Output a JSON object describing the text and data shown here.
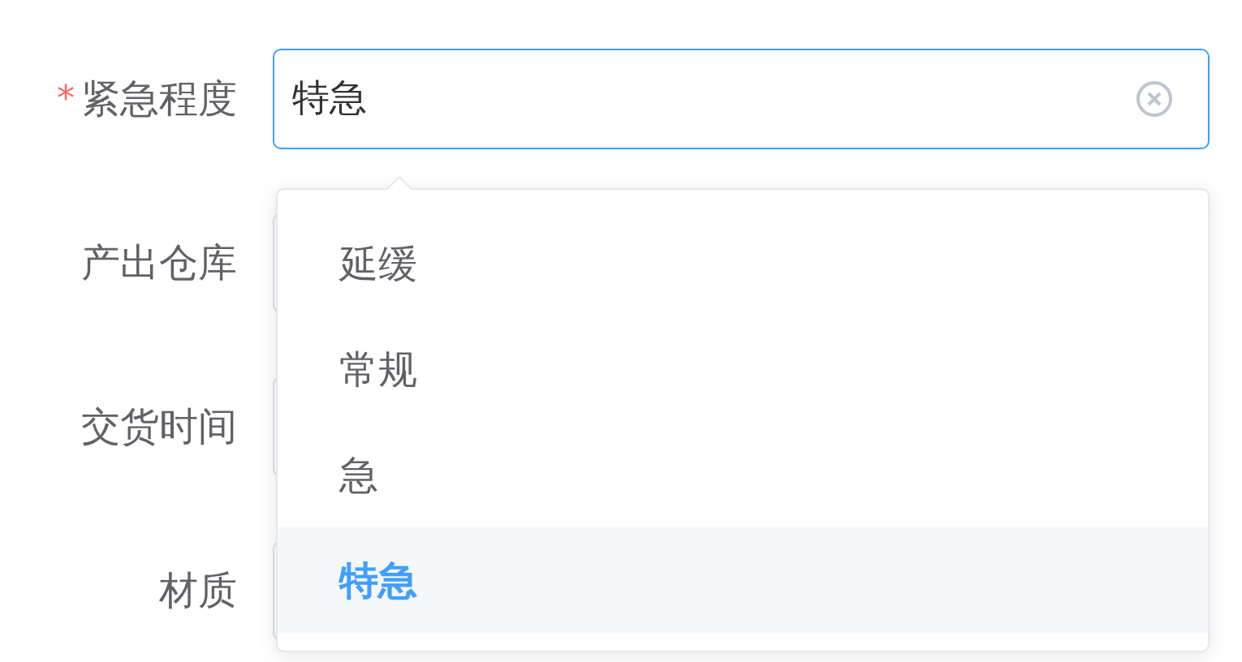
{
  "form": {
    "required_mark": "*",
    "fields": [
      {
        "label": "紧急程度",
        "required": true,
        "value": "特急"
      },
      {
        "label": "产出仓库",
        "required": false
      },
      {
        "label": "交货时间",
        "required": false
      },
      {
        "label": "材质",
        "required": false
      }
    ]
  },
  "dropdown": {
    "options": [
      {
        "label": "延缓",
        "selected": false
      },
      {
        "label": "常规",
        "selected": false
      },
      {
        "label": "急",
        "selected": false
      },
      {
        "label": "特急",
        "selected": true
      }
    ]
  }
}
